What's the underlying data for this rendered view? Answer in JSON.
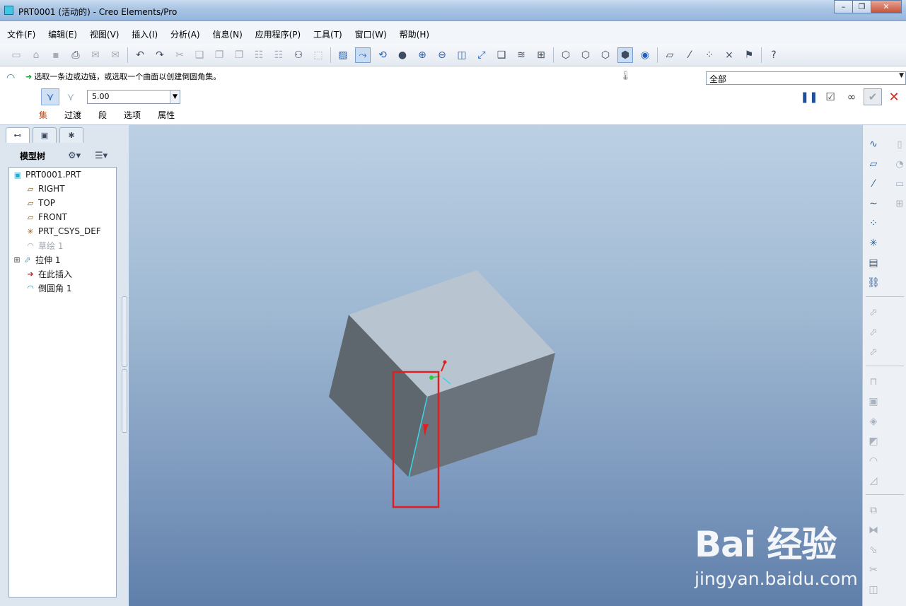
{
  "window": {
    "title": "PRT0001 (活动的) - Creo Elements/Pro",
    "controls": [
      "minimize-icon",
      "restore-icon",
      "close-icon"
    ]
  },
  "menu": [
    "文件(F)",
    "编辑(E)",
    "视图(V)",
    "插入(I)",
    "分析(A)",
    "信息(N)",
    "应用程序(P)",
    "工具(T)",
    "窗口(W)",
    "帮助(H)"
  ],
  "toolbar_icons": [
    "new-icon",
    "open-icon",
    "save-icon",
    "print-icon",
    "email-icon",
    "email-link-icon",
    "undo-icon",
    "redo-icon",
    "cut-icon",
    "copy-icon",
    "paste-icon",
    "paste-special-icon",
    "regenerate-icon",
    "regen-manager-icon",
    "find-icon",
    "select-box-icon",
    "datum-display-icon",
    "spin-center-icon",
    "orient-icon",
    "appearance-icon",
    "zoom-in-icon",
    "zoom-out-icon",
    "refit-icon",
    "reorient-icon",
    "saved-views-icon",
    "layers-icon",
    "view-manager-icon",
    "wireframe-icon",
    "hidden-line-icon",
    "no-hidden-icon",
    "shading-icon",
    "enhanced-realism-icon",
    "datum-planes-icon",
    "datum-axes-icon",
    "datum-points-icon",
    "csys-icon",
    "annotation-icon",
    "help-whats-this-icon"
  ],
  "dashboard": {
    "prompt": "选取一条边或边链，或选取一个曲面以创建倒圆角集。",
    "filter": "全部",
    "radius": "5.00",
    "tabs": [
      "集",
      "过渡",
      "段",
      "选项",
      "属性"
    ],
    "active_tab": "集"
  },
  "navigator": {
    "title": "模型树",
    "tree": [
      {
        "label": "PRT0001.PRT",
        "icon": "part-icon",
        "dim": false
      },
      {
        "label": "RIGHT",
        "icon": "datum-plane-icon",
        "dim": false
      },
      {
        "label": "TOP",
        "icon": "datum-plane-icon",
        "dim": false
      },
      {
        "label": "FRONT",
        "icon": "datum-plane-icon",
        "dim": false
      },
      {
        "label": "PRT_CSYS_DEF",
        "icon": "csys-icon",
        "dim": false
      },
      {
        "label": "草绘 1",
        "icon": "sketch-icon",
        "dim": true
      },
      {
        "label": "拉伸 1",
        "icon": "extrude-icon",
        "dim": false
      },
      {
        "label": "在此插入",
        "icon": "insert-here-icon",
        "dim": false
      },
      {
        "label": "倒圆角 1",
        "icon": "round-icon",
        "dim": false
      }
    ]
  },
  "watermark": {
    "brand": "Bai 经验",
    "url": "jingyan.baidu.com"
  },
  "colors": {
    "highlight": "#e02020",
    "selected_edge": "#38d7e8",
    "cube_top": "#b7c4d2",
    "cube_left": "#5e666e",
    "cube_right": "#6b747c"
  }
}
